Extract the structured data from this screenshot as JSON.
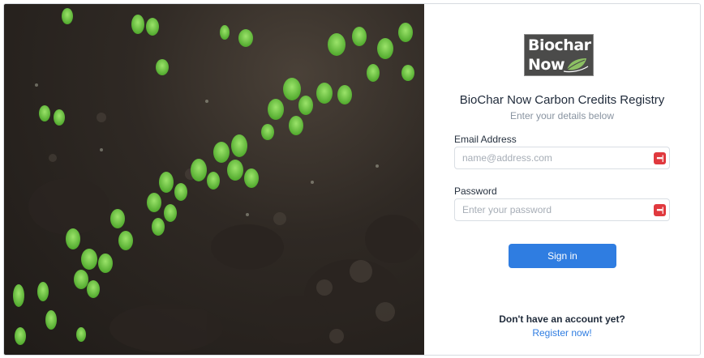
{
  "hero": {
    "icon": "seedlings-soil-photo"
  },
  "logo": {
    "line1": "Biochar",
    "line2": "Now",
    "icon": "leaf-icon"
  },
  "header": {
    "title": "BioChar Now Carbon Credits Registry",
    "subtitle": "Enter your details below"
  },
  "form": {
    "email_label": "Email Address",
    "email_placeholder": "name@address.com",
    "email_value": "",
    "password_label": "Password",
    "password_placeholder": "Enter your password",
    "password_value": "",
    "field_icon": "password-manager-icon",
    "field_icon_glyph": "•••|",
    "signin_label": "Sign in"
  },
  "footer": {
    "no_account_text": "Don't have an account yet?",
    "register_link": "Register now!"
  },
  "colors": {
    "accent": "#2f7de1",
    "field_icon": "#e0393e",
    "logo_bg": "#4b4b4a"
  }
}
